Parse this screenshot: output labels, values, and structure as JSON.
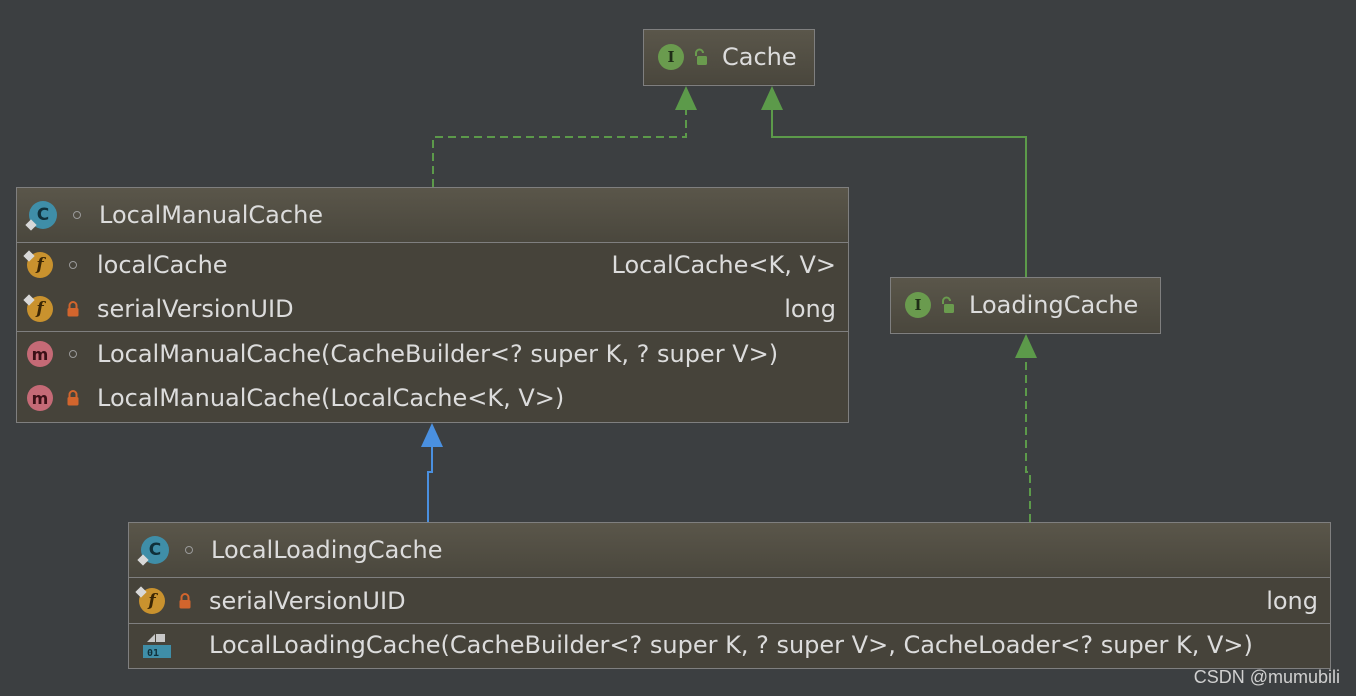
{
  "diagram": {
    "nodes": {
      "cache": {
        "kind": "interface",
        "kind_icon": "interface-icon",
        "visibility_icon": "unlocked-icon",
        "name": "Cache"
      },
      "loading_cache": {
        "kind": "interface",
        "kind_icon": "interface-icon",
        "visibility_icon": "unlocked-icon",
        "name": "LoadingCache"
      },
      "local_manual_cache": {
        "kind": "class",
        "kind_icon": "class-icon",
        "visibility_icon": "package-private-icon",
        "name": "LocalManualCache",
        "fields": [
          {
            "icon": "field-icon",
            "visibility": "package-private",
            "name": "localCache",
            "type": "LocalCache<K, V>"
          },
          {
            "icon": "field-icon",
            "visibility": "private",
            "name": "serialVersionUID",
            "type": "long"
          }
        ],
        "methods": [
          {
            "icon": "method-icon",
            "visibility": "package-private",
            "signature": "LocalManualCache(CacheBuilder<? super K, ? super V>)"
          },
          {
            "icon": "method-icon",
            "visibility": "private",
            "signature": "LocalManualCache(LocalCache<K, V>)"
          }
        ]
      },
      "local_loading_cache": {
        "kind": "class",
        "kind_icon": "class-icon",
        "visibility_icon": "package-private-icon",
        "name": "LocalLoadingCache",
        "fields": [
          {
            "icon": "field-icon",
            "visibility": "private",
            "name": "serialVersionUID",
            "type": "long"
          }
        ],
        "methods": [
          {
            "icon": "constructor-icon",
            "visibility": "none",
            "signature": "LocalLoadingCache(CacheBuilder<? super K, ? super V>, CacheLoader<? super K, V>)"
          }
        ]
      }
    },
    "edges": [
      {
        "from": "LocalManualCache",
        "to": "Cache",
        "relation": "implements",
        "style": "dashed",
        "color": "#5c9a4a"
      },
      {
        "from": "LoadingCache",
        "to": "Cache",
        "relation": "extends",
        "style": "solid",
        "color": "#5c9a4a"
      },
      {
        "from": "LocalLoadingCache",
        "to": "LocalManualCache",
        "relation": "extends",
        "style": "solid",
        "color": "#4a90e0"
      },
      {
        "from": "LocalLoadingCache",
        "to": "LoadingCache",
        "relation": "implements",
        "style": "dashed",
        "color": "#5c9a4a"
      }
    ]
  },
  "colors": {
    "background": "#3c3f41",
    "node_fill": "#46433a",
    "node_border": "#7f7f7f",
    "text": "#dcdcdc",
    "implements_arrow": "#5c9a4a",
    "class_extends_arrow": "#4a90e0"
  },
  "watermark": "CSDN @mumubili"
}
